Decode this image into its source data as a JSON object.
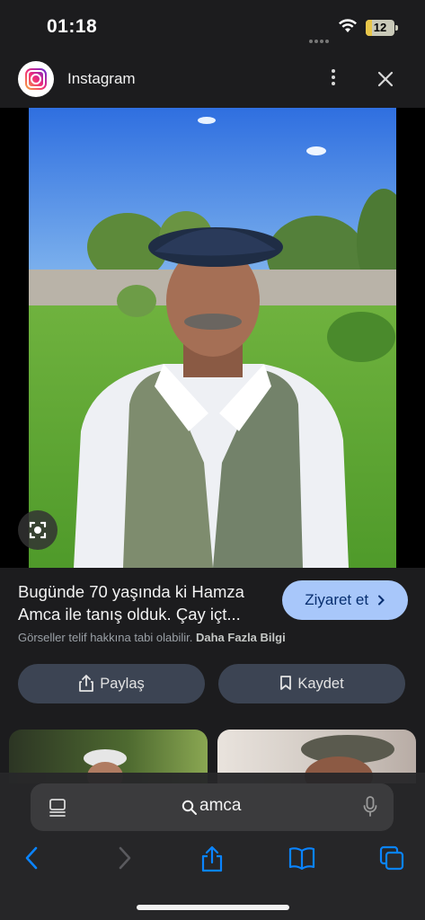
{
  "status_bar": {
    "time": "01:18",
    "battery": "12"
  },
  "source": {
    "name": "Instagram"
  },
  "image": {
    "description_icon": "photo"
  },
  "info": {
    "title_line1": "Bugünde 70 yaşında ki Hamza",
    "title_line2": "Amca ile tanış olduk. Çay içt...",
    "visit_label": "Ziyaret et",
    "copyright_text": "Görseller telif hakkına tabi olabilir.",
    "more_info_label": "Daha Fazla Bilgi",
    "share_label": "Paylaş",
    "save_label": "Kaydet"
  },
  "browser": {
    "search_text": "amca"
  },
  "colors": {
    "accent_button": "#a8c7fa",
    "action_button": "#3c4453",
    "background": "#1c1c1e",
    "browser_link": "#0a84ff"
  }
}
